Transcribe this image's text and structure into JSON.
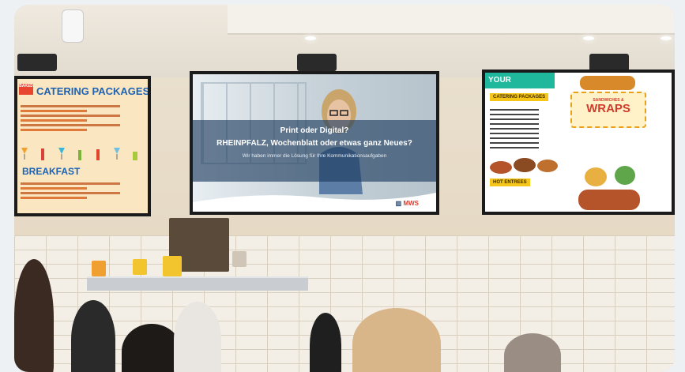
{
  "scene": {
    "description": "",
    "left_screen": {
      "badge": "BAKED",
      "title": "CATERING PACKAGES",
      "section_2": "BREAKFAST"
    },
    "center_screen": {
      "line_1": "Print oder Digital?",
      "line_2": "RHEINPFALZ, Wochenblatt oder etwas ganz Neues?",
      "line_3": "Wir haben immer die Lösung für Ihre Kommunikationsaufgaben",
      "logo": "MWS"
    },
    "right_screen": {
      "header": "YOUR",
      "section_1": "CATERING PACKAGES",
      "promo_small": "SANDWICHES &",
      "promo_big": "WRAPS",
      "section_2": "HOT ENTREES"
    },
    "colors": {
      "menu_blue": "#1e63b3",
      "accent_teal": "#1fb89d",
      "accent_yellow": "#f5c518",
      "logo_red": "#e23a2e"
    }
  }
}
